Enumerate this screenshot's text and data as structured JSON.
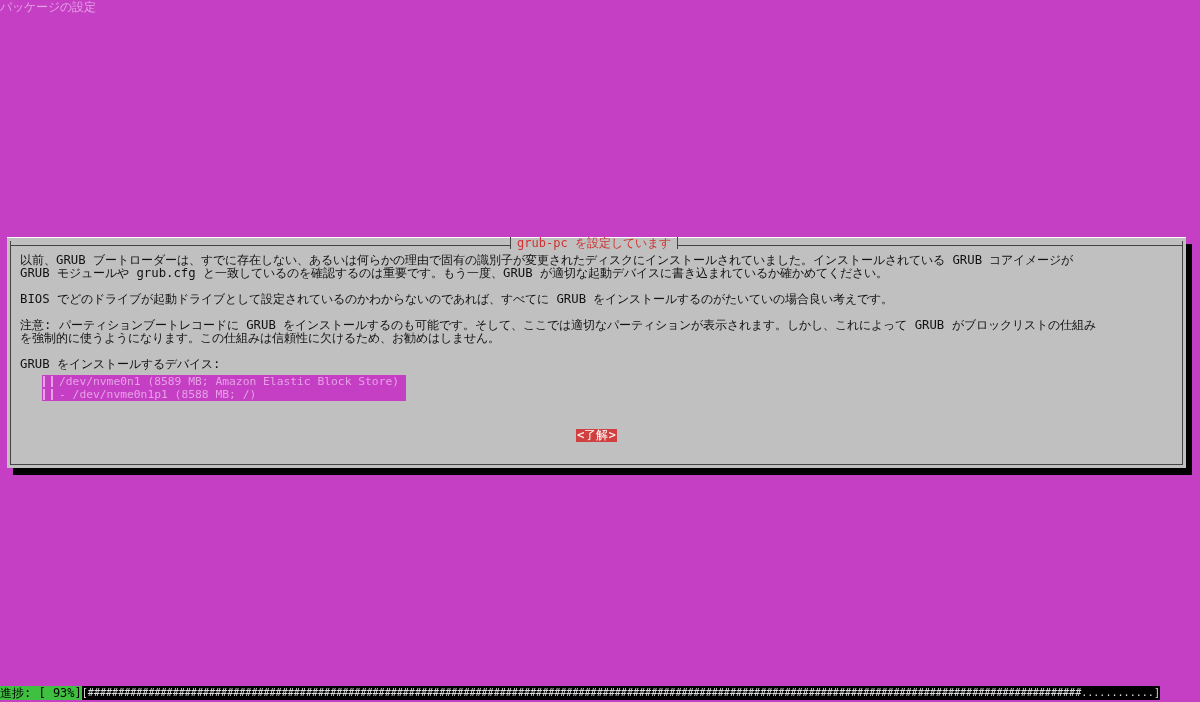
{
  "backtitle": "パッケージの設定",
  "dialog": {
    "title": "grub-pc を設定しています",
    "paragraphs": [
      [
        "以前、GRUB ブートローダーは、すでに存在しない、あるいは何らかの理由で固有の識別子が変更されたディスクにインストールされていました。インストールされている GRUB コアイメージが",
        "GRUB モジュールや grub.cfg と一致しているのを確認するのは重要です。もう一度、GRUB が適切な起動デバイスに書き込まれているか確かめてください。"
      ],
      [
        "BIOS でどのドライブが起動ドライブとして設定されているのかわからないのであれば、すべてに GRUB をインストールするのがたいていの場合良い考えです。"
      ],
      [
        "注意: パーティションブートレコードに GRUB をインストールするのも可能です。そして、ここでは適切なパーティションが表示されます。しかし、これによって GRUB がブロックリストの仕組み",
        "を強制的に使うようになります。この仕組みは信頼性に欠けるため、お勧めはしません。"
      ]
    ],
    "list_label": "GRUB をインストールするデバイス:",
    "devices": [
      {
        "label": "/dev/nvme0n1 (8589 MB; Amazon Elastic Block Store)",
        "checked": false
      },
      {
        "label": "- /dev/nvme0n1p1 (8588 MB; /)",
        "checked": false
      }
    ],
    "button": "<了解>"
  },
  "progress": {
    "label": "進捗: [ 93%]",
    "bar": "[####################################################################################################################################################################............]"
  }
}
